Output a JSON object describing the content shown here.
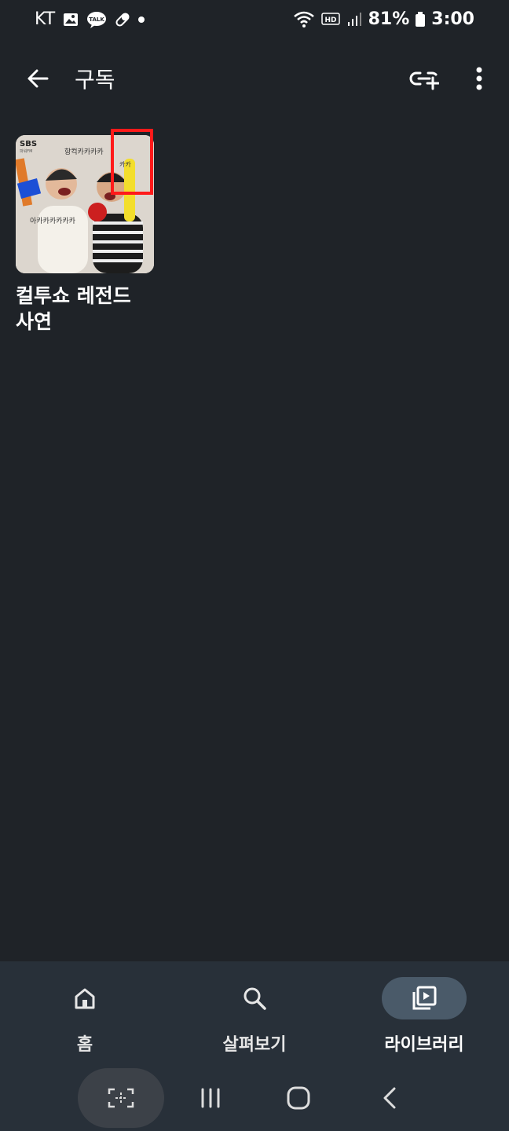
{
  "status_bar": {
    "carrier": "KT",
    "notification_icons": [
      "gallery-icon",
      "kakaotalk-icon",
      "pill-icon",
      "dot-icon"
    ],
    "kakao_label": "TALK",
    "hd_label": "HD",
    "battery": "81%",
    "time": "3:00"
  },
  "app_bar": {
    "title": "구독",
    "icons": [
      "back-arrow-icon",
      "cast-add-icon",
      "more-vert-icon"
    ]
  },
  "subscriptions": [
    {
      "title": "컬투쇼 레전드\n사연",
      "thumbnail": {
        "badge": "SBS",
        "badge_sub": "파워FM",
        "caption_top": "항컥카카카카",
        "caption_left": "아카카카카카카",
        "caption_right": "카카"
      }
    }
  ],
  "bottom_nav": {
    "items": [
      {
        "label": "홈",
        "icon": "home-icon",
        "active": false
      },
      {
        "label": "살펴보기",
        "icon": "search-icon",
        "active": false
      },
      {
        "label": "라이브러리",
        "icon": "library-icon",
        "active": true
      }
    ]
  },
  "system_nav": {
    "icons": [
      "screen-capture-icon",
      "recents-icon",
      "home-circle-icon",
      "back-chevron-icon"
    ]
  },
  "colors": {
    "background": "#1f2328",
    "nav_background": "#283039",
    "active_pill": "#4a5a69",
    "highlight_box": "#ff1a1a"
  }
}
